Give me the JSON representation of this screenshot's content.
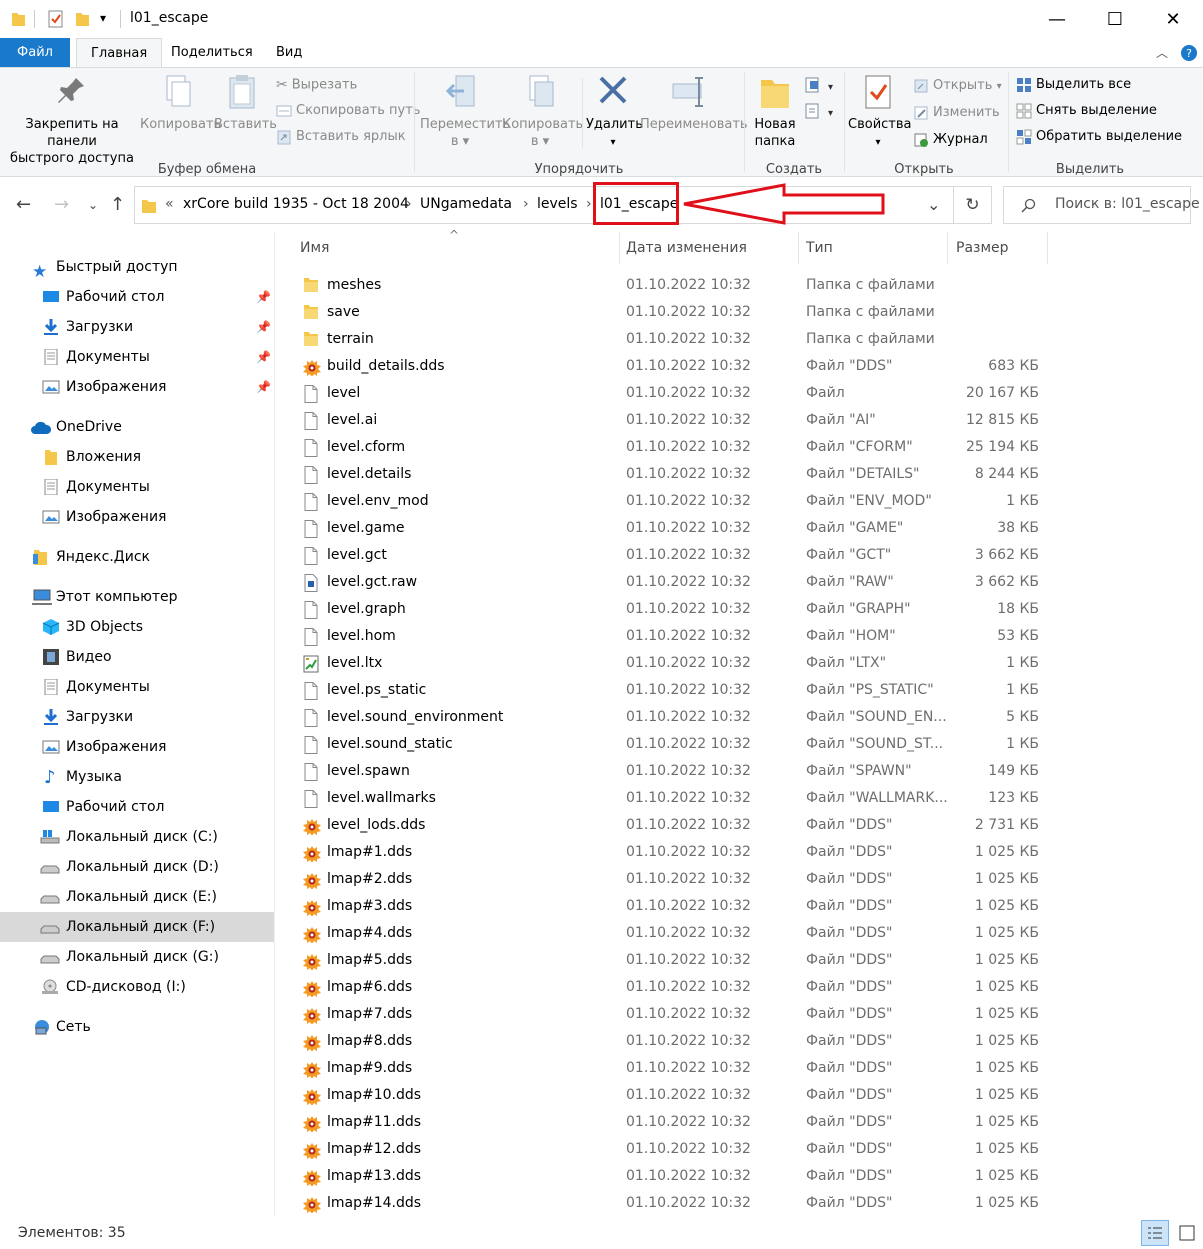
{
  "window": {
    "title": "l01_escape",
    "minimize": "—",
    "maximize": "☐",
    "close": "✕"
  },
  "quick_access": {
    "dropdown": "▾"
  },
  "ribbon": {
    "tabs": {
      "file": "Файл",
      "home": "Главная",
      "share": "Поделиться",
      "view": "Вид"
    },
    "clipboard": {
      "pin_line1": "Закрепить на панели",
      "pin_line2": "быстрого доступа",
      "copy": "Копировать",
      "paste": "Вставить",
      "cut": "Вырезать",
      "copy_path": "Скопировать путь",
      "paste_shortcut": "Вставить ярлык",
      "label": "Буфер обмена"
    },
    "organize": {
      "move_line1": "Переместить",
      "move_line2": "в",
      "copy_line1": "Копировать",
      "copy_line2": "в",
      "delete": "Удалить",
      "rename": "Переименовать",
      "label": "Упорядочить"
    },
    "create": {
      "new_folder_line1": "Новая",
      "new_folder_line2": "папка",
      "label": "Создать"
    },
    "open": {
      "properties": "Свойства",
      "open": "Открыть",
      "edit": "Изменить",
      "history": "Журнал",
      "label": "Открыть"
    },
    "select": {
      "select_all": "Выделить все",
      "select_none": "Снять выделение",
      "invert": "Обратить выделение",
      "label": "Выделить"
    }
  },
  "address": {
    "overflow": "«",
    "crumbs": [
      "xrCore build 1935 - Oct 18 2004",
      "UNgamedata",
      "levels",
      "l01_escape"
    ],
    "separator": "›",
    "search_placeholder": "Поиск в: l01_escape"
  },
  "sidebar": {
    "quick_access": "Быстрый доступ",
    "qa_items": [
      "Рабочий стол",
      "Загрузки",
      "Документы",
      "Изображения"
    ],
    "onedrive": "OneDrive",
    "onedrive_items": [
      "Вложения",
      "Документы",
      "Изображения"
    ],
    "yandex": "Яндекс.Диск",
    "this_pc": "Этот компьютер",
    "pc_items": [
      "3D Objects",
      "Видео",
      "Документы",
      "Загрузки",
      "Изображения",
      "Музыка",
      "Рабочий стол",
      "Локальный диск (C:)",
      "Локальный диск (D:)",
      "Локальный диск (E:)",
      "Локальный диск (F:)",
      "Локальный диск (G:)",
      "CD-дисковод (I:)"
    ],
    "network": "Сеть"
  },
  "columns": {
    "name": "Имя",
    "date": "Дата изменения",
    "type": "Тип",
    "size": "Размер"
  },
  "files": [
    {
      "name": "meshes",
      "date": "01.10.2022 10:32",
      "type": "Папка с файлами",
      "size": "",
      "icon": "folder"
    },
    {
      "name": "save",
      "date": "01.10.2022 10:32",
      "type": "Папка с файлами",
      "size": "",
      "icon": "folder"
    },
    {
      "name": "terrain",
      "date": "01.10.2022 10:32",
      "type": "Папка с файлами",
      "size": "",
      "icon": "folder"
    },
    {
      "name": "build_details.dds",
      "date": "01.10.2022 10:32",
      "type": "Файл \"DDS\"",
      "size": "683 КБ",
      "icon": "dds"
    },
    {
      "name": "level",
      "date": "01.10.2022 10:32",
      "type": "Файл",
      "size": "20 167 КБ",
      "icon": "file"
    },
    {
      "name": "level.ai",
      "date": "01.10.2022 10:32",
      "type": "Файл \"AI\"",
      "size": "12 815 КБ",
      "icon": "file"
    },
    {
      "name": "level.cform",
      "date": "01.10.2022 10:32",
      "type": "Файл \"CFORM\"",
      "size": "25 194 КБ",
      "icon": "file"
    },
    {
      "name": "level.details",
      "date": "01.10.2022 10:32",
      "type": "Файл \"DETAILS\"",
      "size": "8 244 КБ",
      "icon": "file"
    },
    {
      "name": "level.env_mod",
      "date": "01.10.2022 10:32",
      "type": "Файл \"ENV_MOD\"",
      "size": "1 КБ",
      "icon": "file"
    },
    {
      "name": "level.game",
      "date": "01.10.2022 10:32",
      "type": "Файл \"GAME\"",
      "size": "38 КБ",
      "icon": "file"
    },
    {
      "name": "level.gct",
      "date": "01.10.2022 10:32",
      "type": "Файл \"GCT\"",
      "size": "3 662 КБ",
      "icon": "file"
    },
    {
      "name": "level.gct.raw",
      "date": "01.10.2022 10:32",
      "type": "Файл \"RAW\"",
      "size": "3 662 КБ",
      "icon": "raw"
    },
    {
      "name": "level.graph",
      "date": "01.10.2022 10:32",
      "type": "Файл \"GRAPH\"",
      "size": "18 КБ",
      "icon": "file"
    },
    {
      "name": "level.hom",
      "date": "01.10.2022 10:32",
      "type": "Файл \"HOM\"",
      "size": "53 КБ",
      "icon": "file"
    },
    {
      "name": "level.ltx",
      "date": "01.10.2022 10:32",
      "type": "Файл \"LTX\"",
      "size": "1 КБ",
      "icon": "ltx"
    },
    {
      "name": "level.ps_static",
      "date": "01.10.2022 10:32",
      "type": "Файл \"PS_STATIC\"",
      "size": "1 КБ",
      "icon": "file"
    },
    {
      "name": "level.sound_environment",
      "date": "01.10.2022 10:32",
      "type": "Файл \"SOUND_EN...",
      "size": "5 КБ",
      "icon": "file"
    },
    {
      "name": "level.sound_static",
      "date": "01.10.2022 10:32",
      "type": "Файл \"SOUND_ST...",
      "size": "1 КБ",
      "icon": "file"
    },
    {
      "name": "level.spawn",
      "date": "01.10.2022 10:32",
      "type": "Файл \"SPAWN\"",
      "size": "149 КБ",
      "icon": "file"
    },
    {
      "name": "level.wallmarks",
      "date": "01.10.2022 10:32",
      "type": "Файл \"WALLMARK...",
      "size": "123 КБ",
      "icon": "file"
    },
    {
      "name": "level_lods.dds",
      "date": "01.10.2022 10:32",
      "type": "Файл \"DDS\"",
      "size": "2 731 КБ",
      "icon": "dds"
    },
    {
      "name": "lmap#1.dds",
      "date": "01.10.2022 10:32",
      "type": "Файл \"DDS\"",
      "size": "1 025 КБ",
      "icon": "dds"
    },
    {
      "name": "lmap#2.dds",
      "date": "01.10.2022 10:32",
      "type": "Файл \"DDS\"",
      "size": "1 025 КБ",
      "icon": "dds"
    },
    {
      "name": "lmap#3.dds",
      "date": "01.10.2022 10:32",
      "type": "Файл \"DDS\"",
      "size": "1 025 КБ",
      "icon": "dds"
    },
    {
      "name": "lmap#4.dds",
      "date": "01.10.2022 10:32",
      "type": "Файл \"DDS\"",
      "size": "1 025 КБ",
      "icon": "dds"
    },
    {
      "name": "lmap#5.dds",
      "date": "01.10.2022 10:32",
      "type": "Файл \"DDS\"",
      "size": "1 025 КБ",
      "icon": "dds"
    },
    {
      "name": "lmap#6.dds",
      "date": "01.10.2022 10:32",
      "type": "Файл \"DDS\"",
      "size": "1 025 КБ",
      "icon": "dds"
    },
    {
      "name": "lmap#7.dds",
      "date": "01.10.2022 10:32",
      "type": "Файл \"DDS\"",
      "size": "1 025 КБ",
      "icon": "dds"
    },
    {
      "name": "lmap#8.dds",
      "date": "01.10.2022 10:32",
      "type": "Файл \"DDS\"",
      "size": "1 025 КБ",
      "icon": "dds"
    },
    {
      "name": "lmap#9.dds",
      "date": "01.10.2022 10:32",
      "type": "Файл \"DDS\"",
      "size": "1 025 КБ",
      "icon": "dds"
    },
    {
      "name": "lmap#10.dds",
      "date": "01.10.2022 10:32",
      "type": "Файл \"DDS\"",
      "size": "1 025 КБ",
      "icon": "dds"
    },
    {
      "name": "lmap#11.dds",
      "date": "01.10.2022 10:32",
      "type": "Файл \"DDS\"",
      "size": "1 025 КБ",
      "icon": "dds"
    },
    {
      "name": "lmap#12.dds",
      "date": "01.10.2022 10:32",
      "type": "Файл \"DDS\"",
      "size": "1 025 КБ",
      "icon": "dds"
    },
    {
      "name": "lmap#13.dds",
      "date": "01.10.2022 10:32",
      "type": "Файл \"DDS\"",
      "size": "1 025 КБ",
      "icon": "dds"
    },
    {
      "name": "lmap#14.dds",
      "date": "01.10.2022 10:32",
      "type": "Файл \"DDS\"",
      "size": "1 025 КБ",
      "icon": "dds"
    }
  ],
  "status": {
    "items": "Элементов: 35"
  },
  "colors": {
    "accent": "#1979ca",
    "highlight": "#e0101a",
    "selected_bg": "#d9d9d9",
    "folder": "#f4c64a"
  }
}
